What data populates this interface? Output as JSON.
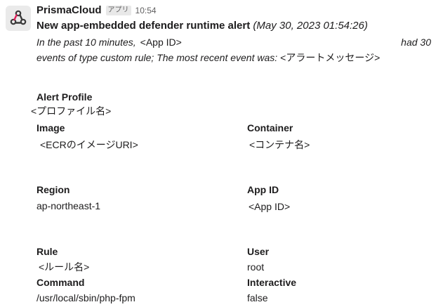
{
  "message": {
    "sender": "PrismaCloud",
    "app_badge": "アプリ",
    "time": "10:54",
    "title": "New app-embedded defender runtime alert",
    "date": "(May 30, 2023 01:54:26)",
    "desc_prefix": "In the past 10 minutes,",
    "desc_app_id": "<App ID>",
    "desc_had": "had 30",
    "desc_line2": "events of type custom rule; The most recent event was:",
    "desc_message": "<アラートメッセージ>"
  },
  "fields": {
    "alert_profile": {
      "label": "Alert Profile",
      "value": "<プロファイル名>"
    },
    "image": {
      "label": "Image",
      "value": "<ECRのイメージURI>"
    },
    "container": {
      "label": "Container",
      "value": "<コンテナ名>"
    },
    "region": {
      "label": "Region",
      "value": "ap-northeast-1"
    },
    "app_id": {
      "label": "App ID",
      "value": "<App ID>"
    },
    "rule": {
      "label": "Rule",
      "value": "<ルール名>"
    },
    "user": {
      "label": "User",
      "value": "root"
    },
    "command": {
      "label": "Command",
      "value": "/usr/local/sbin/php-fpm"
    },
    "interactive": {
      "label": "Interactive",
      "value": "false"
    }
  },
  "icons": {
    "avatar": "prisma-cloud-logo-icon"
  }
}
